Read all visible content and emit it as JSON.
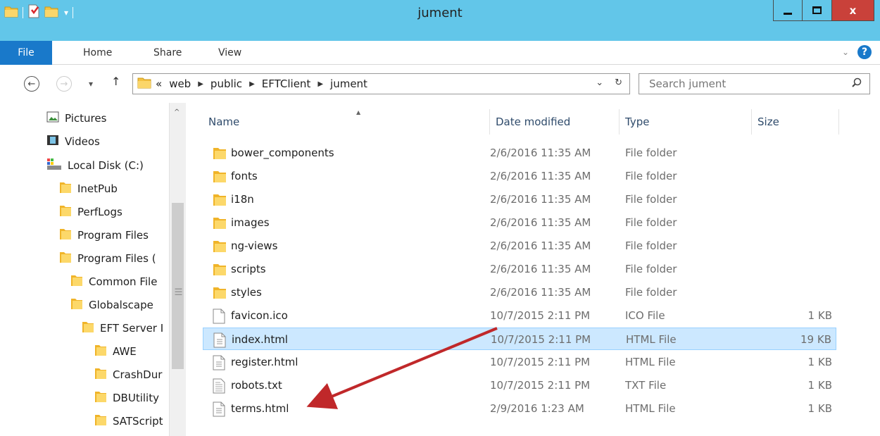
{
  "window": {
    "title": "jument",
    "close_label": "x"
  },
  "ribbon": {
    "tabs": [
      "File",
      "Home",
      "Share",
      "View"
    ],
    "help_label": "?"
  },
  "address": {
    "overflow": "«",
    "crumbs": [
      "web",
      "public",
      "EFTClient",
      "jument"
    ]
  },
  "search": {
    "placeholder": "Search jument"
  },
  "nav_pane": {
    "items": [
      {
        "label": "Pictures",
        "icon": "pictures-icon"
      },
      {
        "label": "Videos",
        "icon": "videos-icon"
      },
      {
        "label": "Local Disk (C:)",
        "icon": "drive-icon"
      },
      {
        "label": "InetPub",
        "icon": "folder-icon"
      },
      {
        "label": "PerfLogs",
        "icon": "folder-icon"
      },
      {
        "label": "Program Files",
        "icon": "folder-icon"
      },
      {
        "label": "Program Files (",
        "icon": "folder-icon"
      },
      {
        "label": "Common File",
        "icon": "folder-icon"
      },
      {
        "label": "Globalscape",
        "icon": "folder-icon"
      },
      {
        "label": "EFT Server I",
        "icon": "folder-icon"
      },
      {
        "label": "AWE",
        "icon": "folder-icon"
      },
      {
        "label": "CrashDur",
        "icon": "folder-icon"
      },
      {
        "label": "DBUtility",
        "icon": "folder-icon"
      },
      {
        "label": "SATScript",
        "icon": "folder-icon"
      }
    ]
  },
  "columns": {
    "name": "Name",
    "date": "Date modified",
    "type": "Type",
    "size": "Size"
  },
  "files": [
    {
      "name": "bower_components",
      "date": "2/6/2016 11:35 AM",
      "type": "File folder",
      "size": "",
      "icon": "folder-icon"
    },
    {
      "name": "fonts",
      "date": "2/6/2016 11:35 AM",
      "type": "File folder",
      "size": "",
      "icon": "folder-icon"
    },
    {
      "name": "i18n",
      "date": "2/6/2016 11:35 AM",
      "type": "File folder",
      "size": "",
      "icon": "folder-icon"
    },
    {
      "name": "images",
      "date": "2/6/2016 11:35 AM",
      "type": "File folder",
      "size": "",
      "icon": "folder-icon"
    },
    {
      "name": "ng-views",
      "date": "2/6/2016 11:35 AM",
      "type": "File folder",
      "size": "",
      "icon": "folder-icon"
    },
    {
      "name": "scripts",
      "date": "2/6/2016 11:35 AM",
      "type": "File folder",
      "size": "",
      "icon": "folder-icon"
    },
    {
      "name": "styles",
      "date": "2/6/2016 11:35 AM",
      "type": "File folder",
      "size": "",
      "icon": "folder-icon"
    },
    {
      "name": "favicon.ico",
      "date": "10/7/2015 2:11 PM",
      "type": "ICO File",
      "size": "1 KB",
      "icon": "blank-file-icon"
    },
    {
      "name": "index.html",
      "date": "10/7/2015 2:11 PM",
      "type": "HTML File",
      "size": "19 KB",
      "icon": "html-file-icon",
      "selected": true
    },
    {
      "name": "register.html",
      "date": "10/7/2015 2:11 PM",
      "type": "HTML File",
      "size": "1 KB",
      "icon": "html-file-icon"
    },
    {
      "name": "robots.txt",
      "date": "10/7/2015 2:11 PM",
      "type": "TXT File",
      "size": "1 KB",
      "icon": "text-file-icon"
    },
    {
      "name": "terms.html",
      "date": "2/9/2016 1:23 AM",
      "type": "HTML File",
      "size": "1 KB",
      "icon": "html-file-icon"
    }
  ],
  "colors": {
    "titlebar": "#62c6e9",
    "file_tab": "#1979ca",
    "close_button": "#c9413a",
    "selection": "#cce8ff",
    "annotation_arrow": "#c0282a"
  }
}
